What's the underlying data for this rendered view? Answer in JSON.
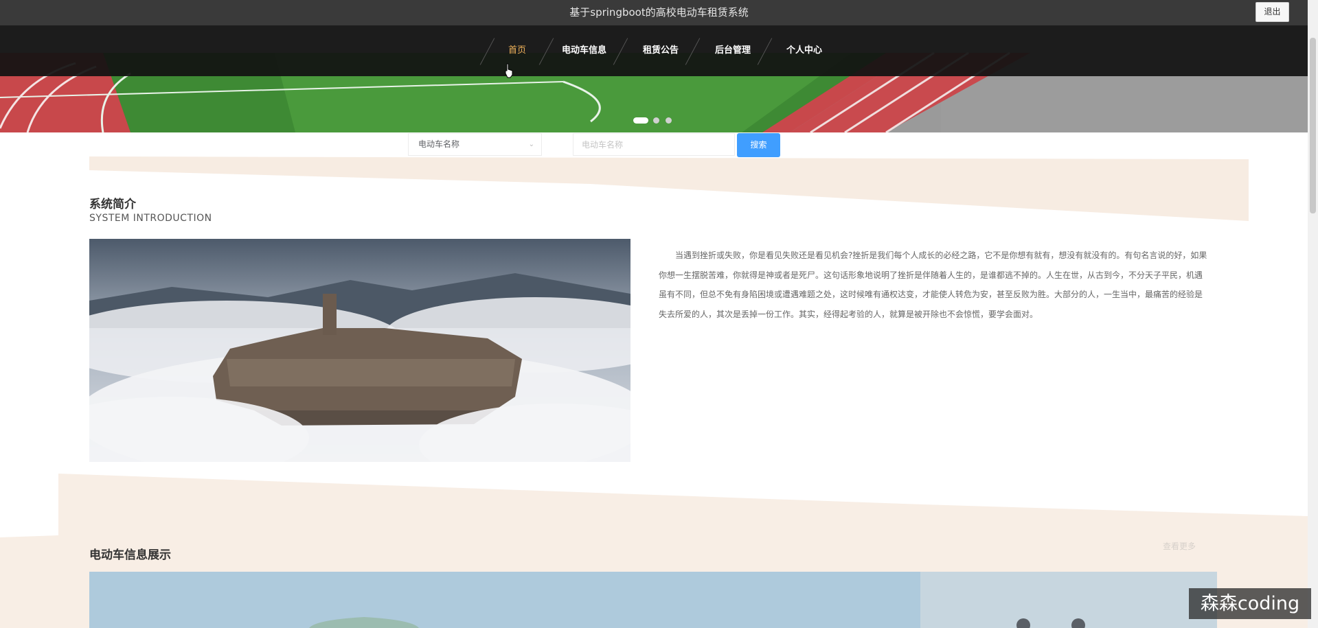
{
  "header": {
    "title": "基于springboot的高校电动车租赁系统",
    "logout_label": "退出"
  },
  "nav": {
    "items": [
      {
        "label": "首页",
        "active": true
      },
      {
        "label": "电动车信息",
        "active": false
      },
      {
        "label": "租赁公告",
        "active": false
      },
      {
        "label": "后台管理",
        "active": false
      },
      {
        "label": "个人中心",
        "active": false
      }
    ]
  },
  "carousel": {
    "slide_count": 3,
    "active_index": 0
  },
  "search": {
    "field_select_value": "电动车名称",
    "input_placeholder": "电动车名称",
    "button_label": "搜索"
  },
  "intro": {
    "title": "系统简介",
    "subtitle": "SYSTEM INTRODUCTION",
    "text": "当遇到挫折或失败，你是看见失败还是看见机会?挫折是我们每个人成长的必经之路，它不是你想有就有，想没有就没有的。有句名言说的好，如果你想一生摆脱苦难，你就得是神或者是死尸。这句话形象地说明了挫折是伴随着人生的，是谁都逃不掉的。人生在世，从古到今，不分天子平民，机遇虽有不同，但总不免有身陷困境或遭遇难题之处，这时候唯有通权达变，才能使人转危为安，甚至反败为胜。大部分的人，一生当中，最痛苦的经验是失去所爱的人，其次是丢掉一份工作。其实，经得起考验的人，就算是被开除也不会惊慌，要学会面对。"
  },
  "vehicles": {
    "title": "电动车信息展示",
    "more_label": "查看更多"
  },
  "watermark": "森森coding",
  "colors": {
    "accent": "#409eff",
    "nav_active": "#f0b35a",
    "title_bar": "#3a3a3a",
    "band": "#f7ece2"
  }
}
